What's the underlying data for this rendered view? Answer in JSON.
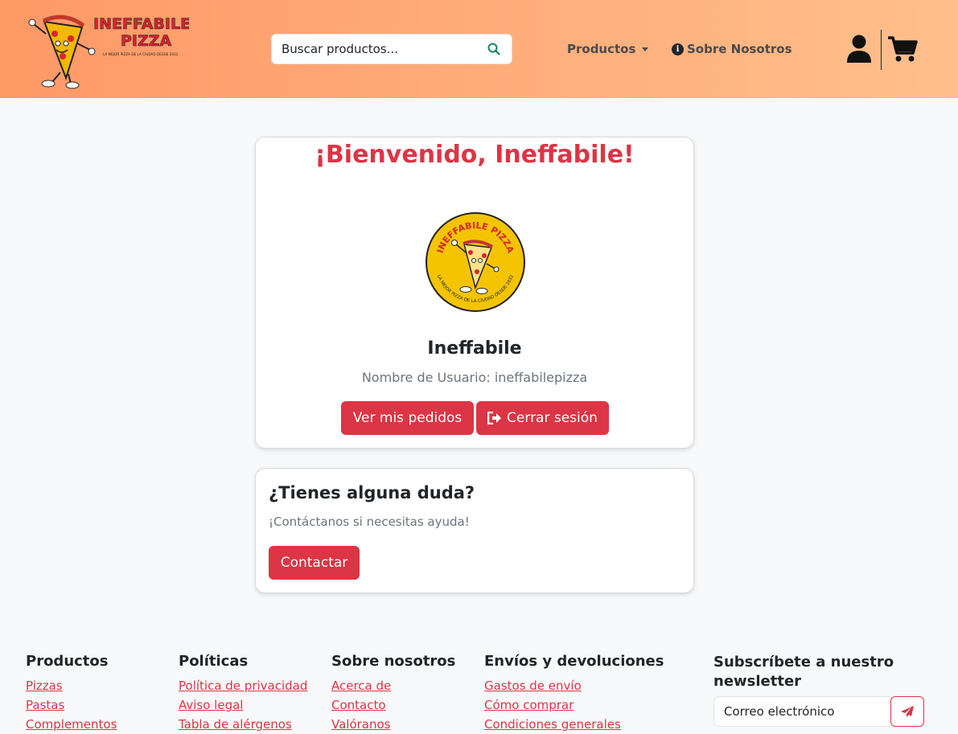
{
  "header": {
    "logo_line1": "INEFFABILE",
    "logo_line2": "PIZZA",
    "logo_tagline": "LA MEJOR PIZZA DE LA CIUDAD DESDE 2032",
    "search_placeholder": "Buscar productos...",
    "nav_products": "Productos",
    "nav_about": "Sobre Nosotros",
    "info_glyph": "i"
  },
  "welcome": {
    "title": "¡Bienvenido, Ineffabile!",
    "badge_top": "INEFFABILE PIZZA",
    "badge_bottom": "LA MEJOR PIZZA DE LA CIUDAD DESDE 2032",
    "name": "Ineffabile",
    "username": "Nombre de Usuario: ineffabilepizza",
    "orders_button": "Ver mis pedidos",
    "logout_button": "Cerrar sesión"
  },
  "help": {
    "title": "¿Tienes alguna duda?",
    "text": "¡Contáctanos si necesitas ayuda!",
    "contact_button": "Contactar"
  },
  "footer": {
    "products": {
      "title": "Productos",
      "links": [
        "Pizzas",
        "Pastas",
        "Complementos"
      ]
    },
    "policies": {
      "title": "Políticas",
      "links": [
        "Política de privacidad",
        "Aviso legal",
        "Tabla de alérgenos"
      ]
    },
    "about": {
      "title": "Sobre nosotros",
      "links": [
        "Acerca de",
        "Contacto",
        "Valóranos"
      ]
    },
    "shipping": {
      "title": "Envíos y devoluciones",
      "links": [
        "Gastos de envío",
        "Cómo comprar",
        "Condiciones generales"
      ]
    },
    "newsletter": {
      "title": "Subscríbete a nuestro newsletter",
      "placeholder": "Correo electrónico"
    }
  },
  "colors": {
    "accent": "#dc3545",
    "header_start": "#ff9966",
    "header_end": "#ffbf8c",
    "badge_yellow": "#f5c400"
  },
  "icons": [
    "search-icon",
    "caret-down-icon",
    "info-icon",
    "user-icon",
    "cart-icon",
    "sign-out-icon",
    "paper-plane-icon"
  ]
}
